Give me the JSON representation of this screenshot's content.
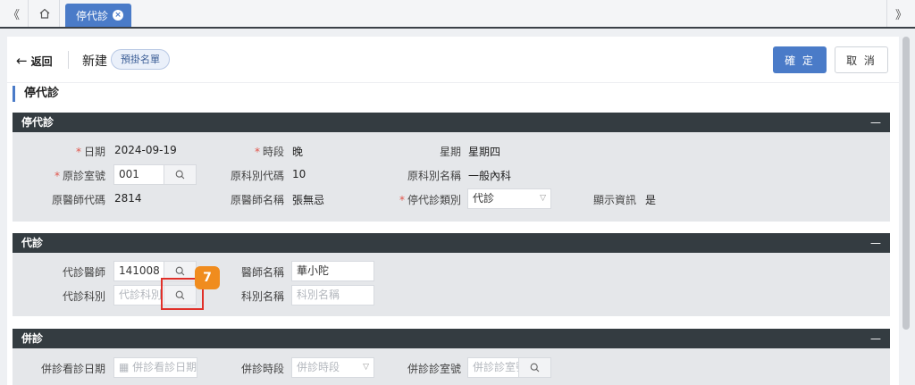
{
  "topbar": {
    "collapse_left": "《",
    "collapse_right": "》",
    "home_icon": "home-icon",
    "tab_label": "停代診",
    "tab_close_icon": "close-icon"
  },
  "header": {
    "back_label": "返回",
    "new_label": "新建",
    "chip_label": "預掛名單",
    "confirm_label": "確 定",
    "cancel_label": "取 消"
  },
  "page_title": "停代診",
  "sections": {
    "stop": {
      "title": "停代診",
      "collapse": "—",
      "date_label": "日期",
      "date_value": "2024-09-19",
      "period_label": "時段",
      "period_value": "晚",
      "weekday_label": "星期",
      "weekday_value": "星期四",
      "room_label": "原診室號",
      "room_value": "001",
      "dept_code_label": "原科別代碼",
      "dept_code_value": "10",
      "dept_name_label": "原科別名稱",
      "dept_name_value": "一般內科",
      "doc_code_label": "原醫師代碼",
      "doc_code_value": "2814",
      "doc_name_label": "原醫師名稱",
      "doc_name_value": "張無忌",
      "type_label": "停代診類別",
      "type_value": "代診",
      "display_label": "顯示資訊",
      "display_value": "是"
    },
    "sub": {
      "title": "代診",
      "collapse": "—",
      "doctor_label": "代診醫師",
      "doctor_value": "141008",
      "doctor_name_label": "醫師名稱",
      "doctor_name_value": "華小陀",
      "dept_label": "代診科別",
      "dept_placeholder": "代診科別",
      "dept_name_label": "科別名稱",
      "dept_name_placeholder": "科別名稱"
    },
    "merge": {
      "title": "併診",
      "collapse": "—",
      "date_label": "併診看診日期",
      "date_placeholder": "併診看診日期",
      "period_label": "併診時段",
      "period_placeholder": "併診時段",
      "room_label": "併診診室號",
      "room_placeholder": "併診診室號"
    }
  },
  "annotation": {
    "step_number": "7"
  },
  "colors": {
    "accent": "#4a7bc8",
    "section_header": "#343c41",
    "required": "#e0554b",
    "highlight": "#e0302a",
    "badge": "#f08c1e"
  }
}
